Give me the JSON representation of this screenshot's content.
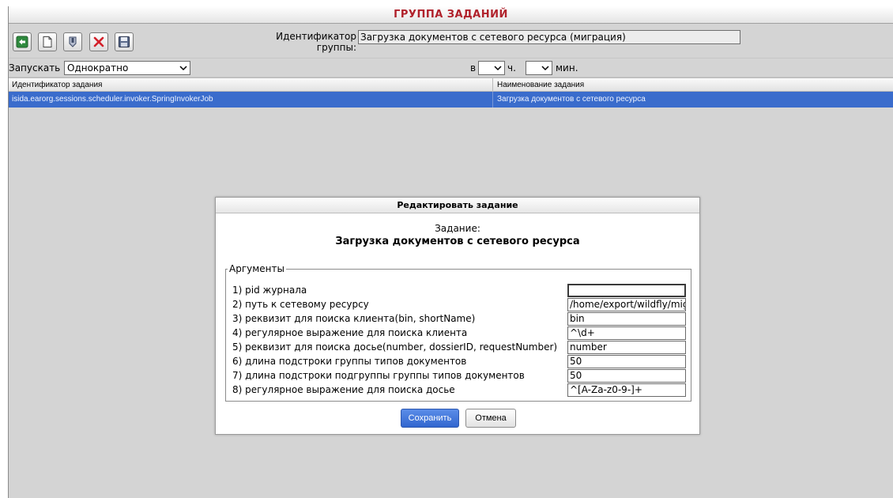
{
  "window": {
    "title": "ГРУППА ЗАДАНИЙ"
  },
  "toolbar": {
    "buttons": [
      {
        "icon": "back-arrow-icon"
      },
      {
        "icon": "new-document-icon"
      },
      {
        "icon": "edit-icon"
      },
      {
        "icon": "delete-icon"
      },
      {
        "icon": "save-disk-icon"
      }
    ],
    "group_id_label": "Идентификатор группы:",
    "group_id_value": "Загрузка документов с сетевого ресурса (миграция)"
  },
  "schedule": {
    "run_label": "Запускать",
    "run_value": "Однократно",
    "at_label": "в",
    "hour_value": "",
    "hour_label": "ч.",
    "minute_value": "",
    "minute_label": "мин."
  },
  "table": {
    "columns": [
      "Идентификатор задания",
      "Наименование задания"
    ],
    "rows": [
      [
        "isida.earorg.sessions.scheduler.invoker.SpringInvokerJob",
        "Загрузка документов с сетевого ресурса"
      ]
    ]
  },
  "dialog": {
    "title": "Редактировать задание",
    "task_caption": "Задание:",
    "task_name": "Загрузка документов с сетевого ресурса",
    "args_legend": "Аргументы",
    "args": [
      {
        "label": "1) pid журнала",
        "value": ""
      },
      {
        "label": "2) путь к сетевому ресурсу",
        "value": "/home/export/wildfly/mig"
      },
      {
        "label": "3) реквизит для поиска клиента(bin, shortName)",
        "value": "bin"
      },
      {
        "label": "4) регулярное выражение для поиска клиента",
        "value": "^\\d+"
      },
      {
        "label": "5) реквизит для поиска досье(number, dossierID, requestNumber)",
        "value": "number"
      },
      {
        "label": "6) длина подстроки группы типов документов",
        "value": "50"
      },
      {
        "label": "7) длина подстроки подгруппы группы типов документов",
        "value": "50"
      },
      {
        "label": "8) регулярное выражение для поиска досье",
        "value": "^[A-Za-z0-9-]+"
      }
    ],
    "save_label": "Сохранить",
    "cancel_label": "Отмена"
  },
  "colors": {
    "title_text": "#b0212b",
    "selection": "#3a6ccc",
    "primary_button": "#3166cf",
    "background": "#d4d4d4"
  }
}
